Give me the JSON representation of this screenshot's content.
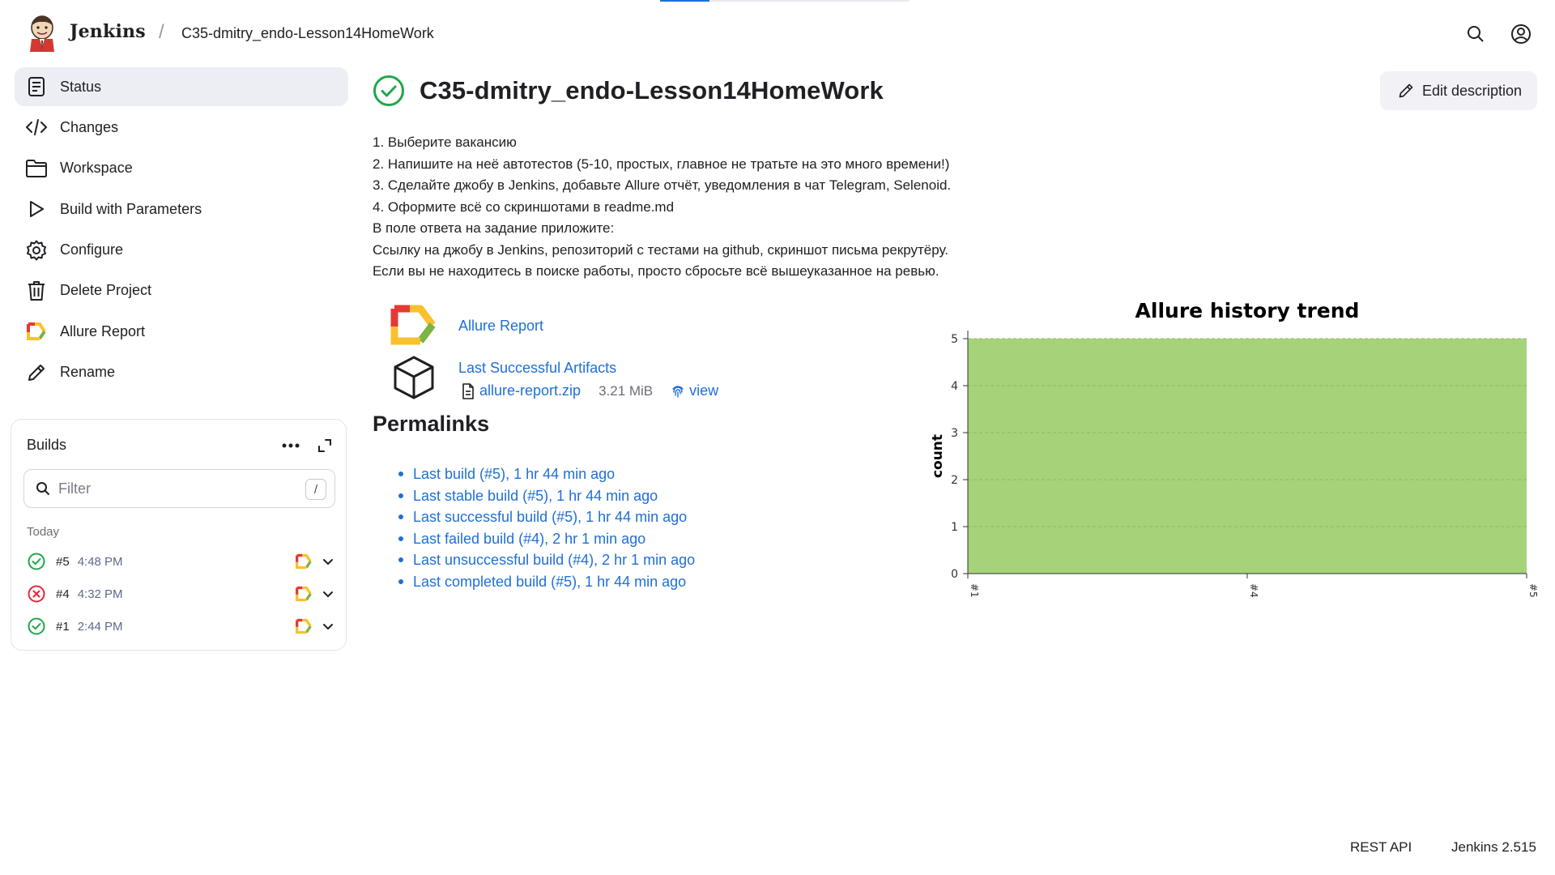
{
  "header": {
    "brand": "Jenkins",
    "breadcrumb": "C35-dmitry_endo-Lesson14HomeWork",
    "search_icon": "search-icon",
    "user_icon": "user-icon"
  },
  "sidebar": {
    "items": [
      {
        "label": "Status",
        "icon": "status-doc-icon",
        "active": true
      },
      {
        "label": "Changes",
        "icon": "code-icon"
      },
      {
        "label": "Workspace",
        "icon": "folder-icon"
      },
      {
        "label": "Build with Parameters",
        "icon": "play-icon"
      },
      {
        "label": "Configure",
        "icon": "gear-icon"
      },
      {
        "label": "Delete Project",
        "icon": "trash-icon"
      },
      {
        "label": "Allure Report",
        "icon": "allure-icon"
      },
      {
        "label": "Rename",
        "icon": "pencil-icon"
      }
    ]
  },
  "builds": {
    "title": "Builds",
    "filter_placeholder": "Filter",
    "filter_shortcut": "/",
    "group_label": "Today",
    "rows": [
      {
        "number": "#5",
        "time": "4:48 PM",
        "status": "success"
      },
      {
        "number": "#4",
        "time": "4:32 PM",
        "status": "failed"
      },
      {
        "number": "#1",
        "time": "2:44 PM",
        "status": "success"
      }
    ]
  },
  "main": {
    "title": "C35-dmitry_endo-Lesson14HomeWork",
    "edit_description": "Edit description",
    "description_lines": [
      "1. Выберите вакансию",
      "2. Напишите на неё автотестов (5-10, простых, главное не тратьте на это много времени!)",
      "3. Сделайте джобу в Jenkins, добавьте Allure отчёт, уведомления в чат Telegram, Selenoid.",
      "4. Оформите всё со скриншотами в readme.md",
      "В поле ответа на задание приложите:",
      "Ссылку на джобу в Jenkins, репозиторий с тестами на github, скриншот письма рекрутёру.",
      "Если вы не находитесь в поиске работы, просто сбросьте всё вышеуказанное на ревью."
    ],
    "allure_report_link": "Allure Report",
    "artifacts_link": "Last Successful Artifacts",
    "artifact_file": "allure-report.zip",
    "artifact_size": "3.21 MiB",
    "artifact_view": "view",
    "permalinks_title": "Permalinks",
    "permalinks": [
      "Last build (#5), 1 hr 44 min ago",
      "Last stable build (#5), 1 hr 44 min ago",
      "Last successful build (#5), 1 hr 44 min ago",
      "Last failed build (#4), 2 hr 1 min ago",
      "Last unsuccessful build (#4), 2 hr 1 min ago",
      "Last completed build (#5), 1 hr 44 min ago"
    ]
  },
  "chart_data": {
    "type": "area",
    "title": "Allure history trend",
    "xlabel": "",
    "ylabel": "count",
    "categories": [
      "#1",
      "#4",
      "#5"
    ],
    "series": [
      {
        "values": [
          5,
          5,
          5
        ],
        "color": "#a6d27a"
      }
    ],
    "ylim": [
      0,
      5
    ],
    "yticks": [
      0,
      1,
      2,
      3,
      4,
      5
    ],
    "grid": true
  },
  "footer": {
    "rest_api": "REST API",
    "version": "Jenkins 2.515"
  },
  "colors": {
    "link": "#1f6fd6",
    "success": "#1fa74a",
    "failure": "#e0283c",
    "chart_fill": "#a6d27a"
  }
}
